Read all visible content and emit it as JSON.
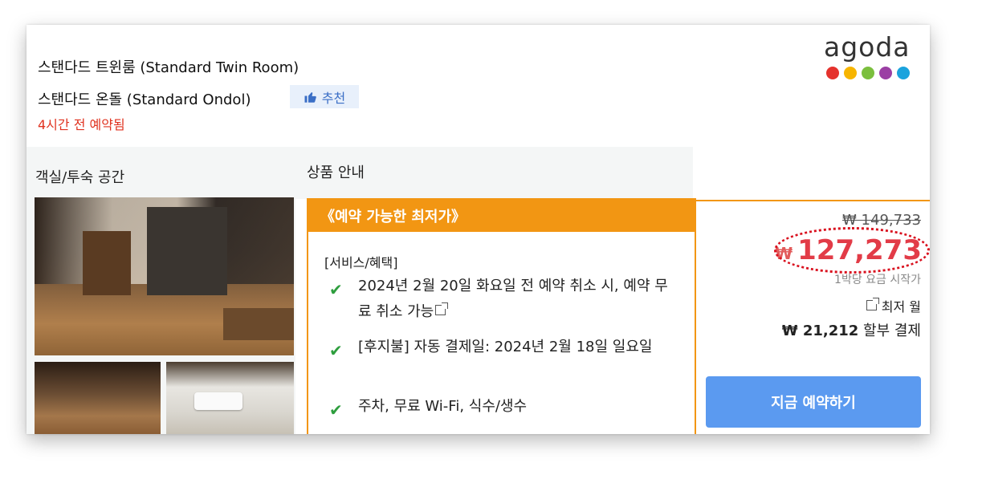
{
  "room": {
    "title_primary": "스탠다드 트윈룸 (Standard Twin Room)",
    "title_secondary": "스탠다드 온돌 (Standard Ondol)",
    "recommend_badge": "추천",
    "booked_notice": "4시간 전 예약됨"
  },
  "brand": {
    "logo_text": "agoda",
    "dot_colors": [
      "#e5322d",
      "#f7b500",
      "#7bbf3e",
      "#9b3fa4",
      "#1ba3dd"
    ]
  },
  "left_panel": {
    "label": "객실/투숙 공간"
  },
  "product": {
    "section_label": "상품 안내",
    "lowest_price_banner": "《예약 가능한 최저가》",
    "services_title": "[서비스/혜택]",
    "benefits": [
      "2024년 2월 20일 화요일 전 예약 취소 시, 예약 무료 취소 가능",
      "[후지불] 자동 결제일: 2024년 2월 18일 일요일",
      "주차, 무료 Wi-Fi, 식수/생수"
    ]
  },
  "pricing": {
    "original_price": "₩ 149,733",
    "currency_symbol": "₩",
    "sale_price": "127,273",
    "per_night_note": "1박당 요금 시작가",
    "min_month_label": "최저 월",
    "installment_amount": "₩ 21,212",
    "installment_label": "할부 결제",
    "accent_color": "#e23b47"
  },
  "actions": {
    "book_now": "지금 예약하기"
  }
}
